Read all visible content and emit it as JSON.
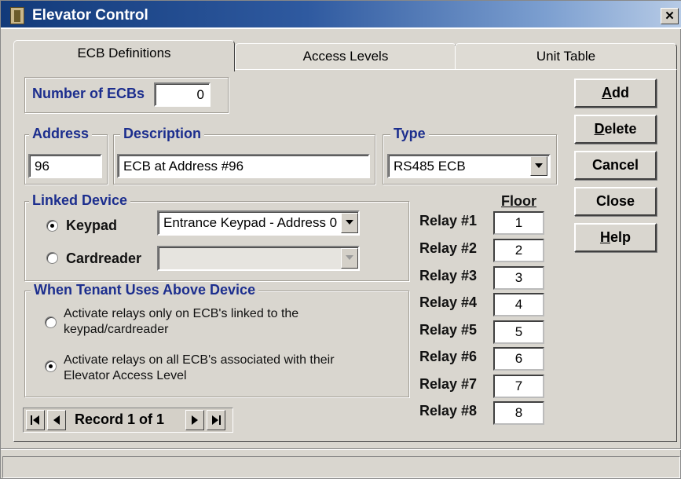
{
  "window": {
    "title": "Elevator Control",
    "close_symbol": "✕"
  },
  "tabs": [
    {
      "label": "ECB Definitions",
      "active": true
    },
    {
      "label": "Access Levels",
      "active": false
    },
    {
      "label": "Unit Table",
      "active": false
    }
  ],
  "ecb_count": {
    "label": "Number of ECBs",
    "value": "0"
  },
  "address": {
    "label": "Address",
    "value": "96"
  },
  "description": {
    "label": "Description",
    "value": "ECB at Address #96"
  },
  "type": {
    "label": "Type",
    "value": "RS485 ECB"
  },
  "linked_device": {
    "label": "Linked Device",
    "keypad": {
      "label": "Keypad",
      "selected": true,
      "value": "Entrance Keypad - Address 0"
    },
    "cardreader": {
      "label": "Cardreader",
      "selected": false,
      "value": ""
    }
  },
  "tenant": {
    "label": "When Tenant Uses Above Device",
    "option1": {
      "line1": "Activate relays only on ECB's linked to the",
      "line2": "keypad/cardreader",
      "selected": false
    },
    "option2": {
      "line1": "Activate relays on all ECB's associated with their",
      "line2": "Elevator Access Level",
      "selected": true
    }
  },
  "floor_header": "Floor",
  "relays": [
    {
      "label": "Relay #1",
      "floor": "1"
    },
    {
      "label": "Relay #2",
      "floor": "2"
    },
    {
      "label": "Relay #3",
      "floor": "3"
    },
    {
      "label": "Relay #4",
      "floor": "4"
    },
    {
      "label": "Relay #5",
      "floor": "5"
    },
    {
      "label": "Relay #6",
      "floor": "6"
    },
    {
      "label": "Relay #7",
      "floor": "7"
    },
    {
      "label": "Relay #8",
      "floor": "8"
    }
  ],
  "buttons": {
    "add": {
      "u": "A",
      "rest": "dd"
    },
    "delete": {
      "u": "D",
      "rest": "elete"
    },
    "cancel": "Cancel",
    "close": "Close",
    "help": {
      "u": "H",
      "rest": "elp"
    }
  },
  "record_nav": {
    "text": "Record 1 of 1"
  },
  "colors": {
    "label_blue": "#1c2e8e",
    "title_bar": "#123a7a"
  }
}
